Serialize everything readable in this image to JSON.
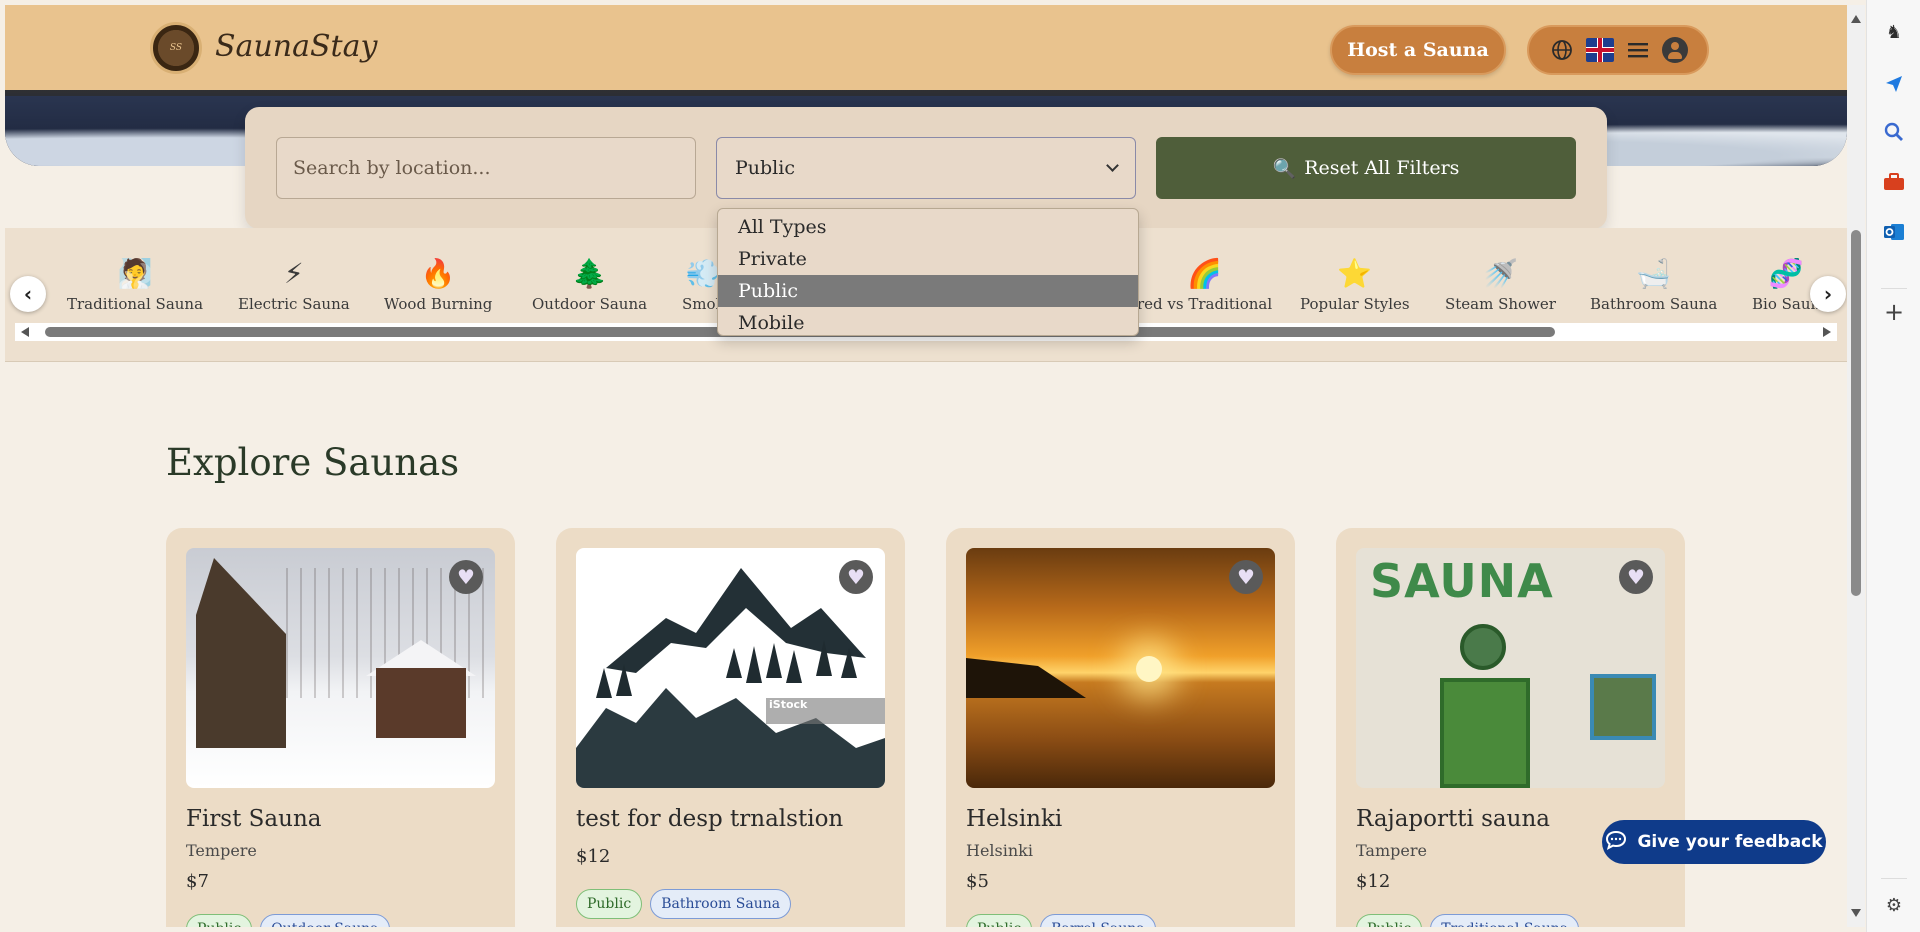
{
  "header": {
    "brand": "SaunaStay",
    "host_button": "Host a Sauna",
    "icons": [
      "globe-icon",
      "uk-flag-icon",
      "hamburger-menu-icon",
      "user-avatar-icon"
    ]
  },
  "search": {
    "placeholder": "Search by location...",
    "type_selected": "Public",
    "type_options": [
      "All Types",
      "Private",
      "Public",
      "Mobile"
    ],
    "reset_label": "Reset All Filters",
    "reset_icon": "🔍"
  },
  "categories": [
    {
      "icon": "🧖",
      "label": "Traditional Sauna"
    },
    {
      "icon": "⚡",
      "label": "Electric Sauna"
    },
    {
      "icon": "🔥",
      "label": "Wood Burning"
    },
    {
      "icon": "🌲",
      "label": "Outdoor Sauna"
    },
    {
      "icon": "💨",
      "label": "Smok"
    },
    {
      "icon": "🌈",
      "label": "red vs Traditional"
    },
    {
      "icon": "⭐",
      "label": "Popular Styles"
    },
    {
      "icon": "🚿",
      "label": "Steam Shower"
    },
    {
      "icon": "🛁",
      "label": "Bathroom Sauna"
    },
    {
      "icon": "🧬",
      "label": "Bio Saun"
    }
  ],
  "explore": {
    "title": "Explore Saunas",
    "cards": [
      {
        "title": "First Sauna",
        "location": "Tempere",
        "price": "$7",
        "tags": [
          "Public",
          "Outdoor Sauna"
        ]
      },
      {
        "title": "test for desp trnalstion",
        "location": "",
        "price": "$12",
        "tags": [
          "Public",
          "Bathroom Sauna"
        ]
      },
      {
        "title": "Helsinki",
        "location": "Helsinki",
        "price": "$5",
        "tags": [
          "Public",
          "Barrel Sauna"
        ]
      },
      {
        "title": "Rajaportti sauna",
        "location": "Tampere",
        "price": "$12",
        "tags": [
          "Public",
          "Traditional Sauna"
        ]
      }
    ],
    "image_overlay_text": "iStock"
  },
  "feedback": {
    "label": "Give your feedback"
  },
  "colors": {
    "header": "#e9c38e",
    "accent": "#c87f3e",
    "reset": "#4f5e3a",
    "feedback": "#0f3b8a",
    "background": "#f5efe6"
  }
}
